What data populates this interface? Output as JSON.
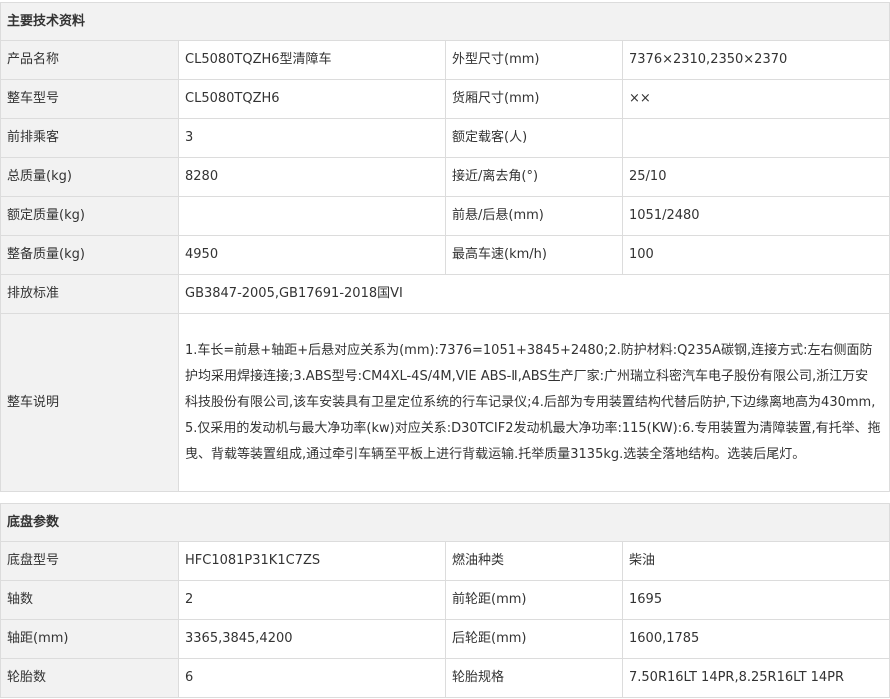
{
  "main_specs": {
    "title": "主要技术资料",
    "rows": [
      {
        "l1": "产品名称",
        "v1": "CL5080TQZH6型清障车",
        "l2": "外型尺寸(mm)",
        "v2": "7376×2310,2350×2370"
      },
      {
        "l1": "整车型号",
        "v1": "CL5080TQZH6",
        "l2": "货厢尺寸(mm)",
        "v2": "××"
      },
      {
        "l1": "前排乘客",
        "v1": "3",
        "l2": "额定载客(人)",
        "v2": ""
      },
      {
        "l1": "总质量(kg)",
        "v1": "8280",
        "l2": "接近/离去角(°)",
        "v2": "25/10"
      },
      {
        "l1": "额定质量(kg)",
        "v1": "",
        "l2": "前悬/后悬(mm)",
        "v2": "1051/2480"
      },
      {
        "l1": "整备质量(kg)",
        "v1": "4950",
        "l2": "最高车速(km/h)",
        "v2": "100"
      }
    ],
    "emission_label": "排放标准",
    "emission_value": "GB3847-2005,GB17691-2018国VI",
    "desc_label": "整车说明",
    "desc_value": "1.车长=前悬+轴距+后悬对应关系为(mm):7376=1051+3845+2480;2.防护材料:Q235A碳钢,连接方式:左右侧面防护均采用焊接连接;3.ABS型号:CM4XL-4S/4M,VIE ABS-Ⅱ,ABS生产厂家:广州瑞立科密汽车电子股份有限公司,浙江万安科技股份有限公司,该车安装具有卫星定位系统的行车记录仪;4.后部为专用装置结构代替后防护,下边缘离地高为430mm,5.仅采用的发动机与最大净功率(kw)对应关系:D30TCIF2发动机最大净功率:115(KW):6.专用装置为清障装置,有托举、拖曳、背载等装置组成,通过牵引车辆至平板上进行背载运输.托举质量3135kg.选装全落地结构。选装后尾灯。"
  },
  "chassis_specs": {
    "title": "底盘参数",
    "rows": [
      {
        "l1": "底盘型号",
        "v1": "HFC1081P31K1C7ZS",
        "l2": "燃油种类",
        "v2": "柴油"
      },
      {
        "l1": "轴数",
        "v1": "2",
        "l2": "前轮距(mm)",
        "v2": "1695"
      },
      {
        "l1": "轴距(mm)",
        "v1": "3365,3845,4200",
        "l2": "后轮距(mm)",
        "v2": "1600,1785"
      },
      {
        "l1": "轮胎数",
        "v1": "6",
        "l2": "轮胎规格",
        "v2": "7.50R16LT 14PR,8.25R16LT 14PR"
      }
    ]
  }
}
